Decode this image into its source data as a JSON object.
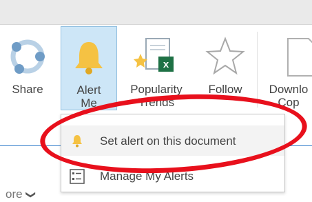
{
  "ribbon": {
    "share_label": "Share",
    "alert_label_line1": "Alert",
    "alert_label_line2": "Me",
    "popularity_label_line1": "Popularity",
    "popularity_label_line2": "Trends",
    "follow_label": "Follow",
    "download_label_line1": "Downlo",
    "download_label_line2": "Cop"
  },
  "alert_menu": {
    "set_alert_label": "Set alert on this document",
    "manage_alerts_label": "Manage My Alerts"
  },
  "footer": {
    "more_label": "ore"
  },
  "colors": {
    "accent": "#2b79c8",
    "selected_bg": "#cde6f7",
    "highlight_circle": "#e8101c",
    "bell": "#f5c243",
    "excel_green": "#1e7145"
  },
  "icons": [
    "share-icon",
    "bell-icon",
    "popularity-trends-icon",
    "star-icon",
    "download-document-icon",
    "list-icon",
    "chevron-down-icon"
  ]
}
